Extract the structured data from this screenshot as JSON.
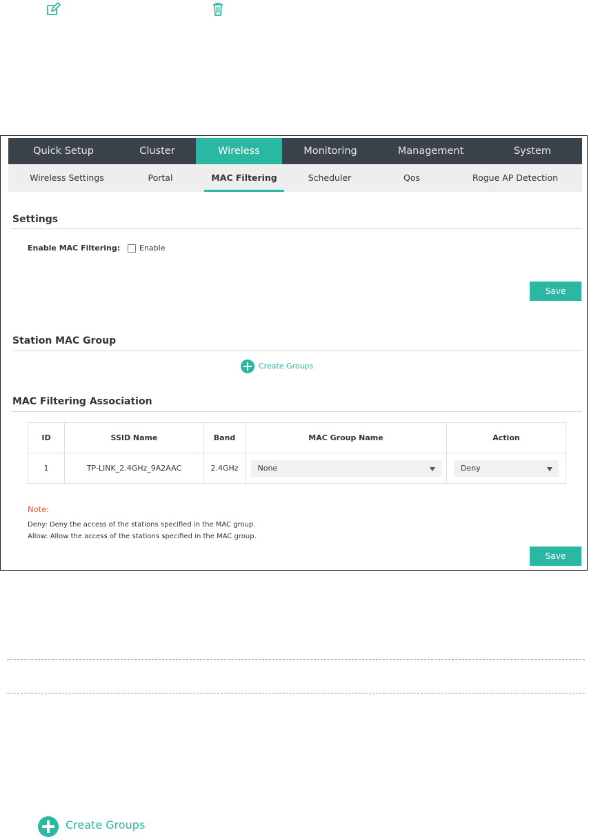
{
  "top_icons": {
    "edit": "edit-icon",
    "delete": "trash-icon"
  },
  "nav": {
    "main": [
      "Quick Setup",
      "Cluster",
      "Wireless",
      "Monitoring",
      "Management",
      "System"
    ],
    "active_main": "Wireless",
    "sub": [
      "Wireless Settings",
      "Portal",
      "MAC Filtering",
      "Scheduler",
      "Qos",
      "Rogue AP Detection"
    ],
    "active_sub": "MAC Filtering"
  },
  "settings": {
    "title": "Settings",
    "enable_label": "Enable MAC Filtering:",
    "enable_checkbox_label": "Enable",
    "enable_checked": false,
    "save_label": "Save"
  },
  "station_group": {
    "title": "Station MAC Group",
    "create_label": "Create Groups"
  },
  "association": {
    "title": "MAC Filtering Association",
    "columns": [
      "ID",
      "SSID Name",
      "Band",
      "MAC Group Name",
      "Action"
    ],
    "rows": [
      {
        "id": "1",
        "ssid": "TP-LINK_2.4GHz_9A2AAC",
        "band": "2.4GHz",
        "group": "None",
        "action": "Deny"
      }
    ]
  },
  "note": {
    "title": "Note:",
    "lines": [
      "Deny: Deny the access of the stations specified in the MAC group.",
      "Allow: Allow the access of the stations specified in the MAC group."
    ]
  },
  "bottom_save_label": "Save",
  "bottom_create_label": "Create Groups",
  "colors": {
    "accent": "#2bb8a3",
    "nav_dark": "#3b424c",
    "note": "#e8542e"
  }
}
